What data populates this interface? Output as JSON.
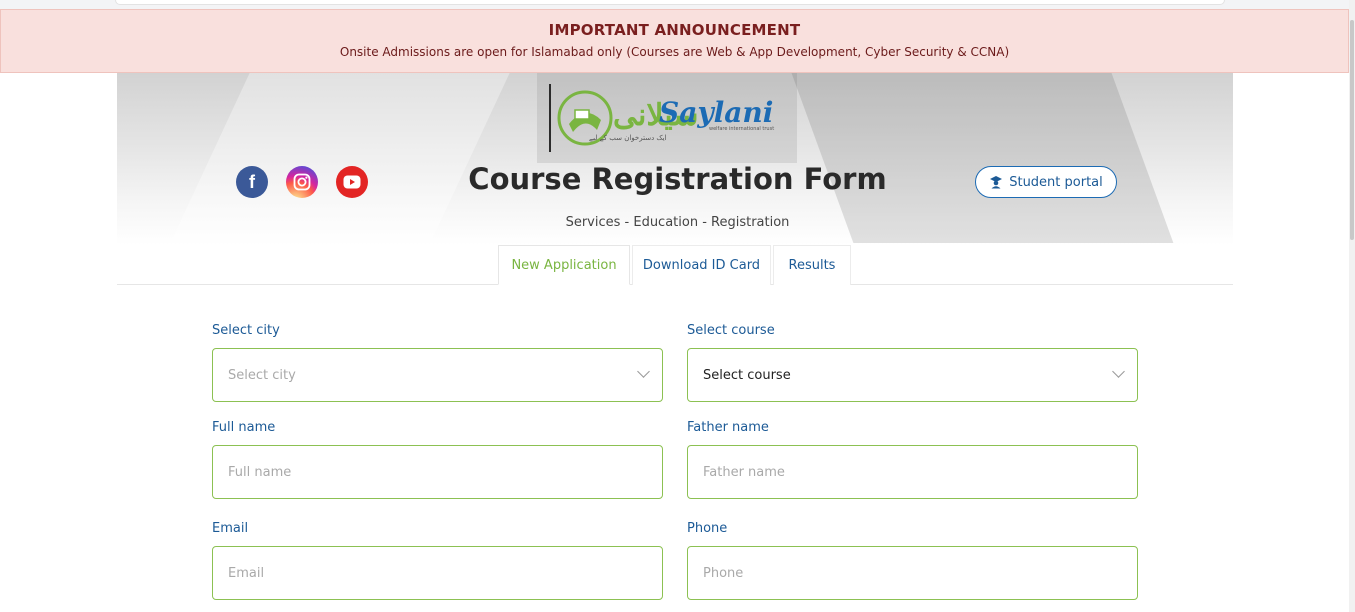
{
  "announcement": {
    "title": "IMPORTANT ANNOUNCEMENT",
    "message": "Onsite Admissions are open for Islamabad only (Courses are Web & App Development, Cyber Security & CCNA)"
  },
  "logo": {
    "urdu": "سیلانی",
    "brand": "Saylani",
    "subtext": "welfare international trust",
    "tagline": "ایک دسترخوان سب کے لیے"
  },
  "social": {
    "facebook": "f",
    "instagram_icon": "instagram-icon",
    "youtube_icon": "youtube-icon"
  },
  "header": {
    "title": "Course Registration Form",
    "subtitle": "Services - Education - Registration",
    "portal_label": "Student portal"
  },
  "tabs": [
    {
      "label": "New Application",
      "active": true
    },
    {
      "label": "Download ID Card",
      "active": false
    },
    {
      "label": "Results",
      "active": false
    }
  ],
  "form": {
    "city": {
      "label": "Select city",
      "placeholder": "Select city"
    },
    "course": {
      "label": "Select course",
      "value": "Select course"
    },
    "full_name": {
      "label": "Full name",
      "placeholder": "Full name"
    },
    "father_name": {
      "label": "Father name",
      "placeholder": "Father name"
    },
    "email": {
      "label": "Email",
      "placeholder": "Email"
    },
    "phone": {
      "label": "Phone",
      "placeholder": "Phone"
    }
  },
  "colors": {
    "accent_green": "#7ab541",
    "primary_blue": "#1c6bb4",
    "announcement_bg": "#f9e0dd",
    "announcement_text": "#7a1f1f"
  }
}
